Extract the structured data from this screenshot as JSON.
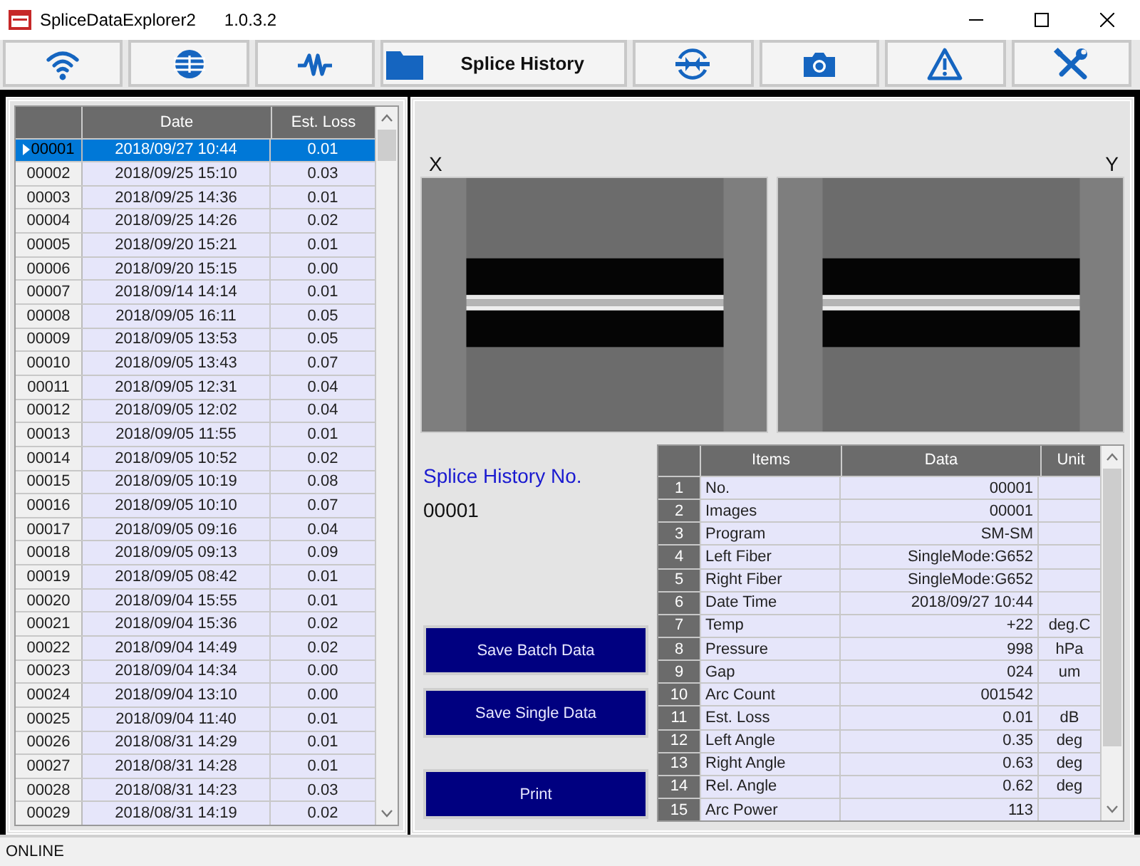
{
  "window": {
    "title": "SpliceDataExplorer2",
    "version": "1.0.3.2"
  },
  "toolbar": [
    {
      "kind": "wifi"
    },
    {
      "kind": "fiber"
    },
    {
      "kind": "wave"
    },
    {
      "kind": "folder",
      "label": "Splice History"
    },
    {
      "kind": "splice"
    },
    {
      "kind": "camera"
    },
    {
      "kind": "warning"
    },
    {
      "kind": "tools"
    }
  ],
  "history": {
    "columns": [
      "Date",
      "Est. Loss"
    ],
    "rows": [
      {
        "no": "00001",
        "date": "2018/09/27 10:44",
        "loss": "0.01",
        "selected": true
      },
      {
        "no": "00002",
        "date": "2018/09/25 15:10",
        "loss": "0.03",
        "selected": false
      },
      {
        "no": "00003",
        "date": "2018/09/25 14:36",
        "loss": "0.01",
        "selected": false
      },
      {
        "no": "00004",
        "date": "2018/09/25 14:26",
        "loss": "0.02",
        "selected": false
      },
      {
        "no": "00005",
        "date": "2018/09/20 15:21",
        "loss": "0.01",
        "selected": false
      },
      {
        "no": "00006",
        "date": "2018/09/20 15:15",
        "loss": "0.00",
        "selected": false
      },
      {
        "no": "00007",
        "date": "2018/09/14 14:14",
        "loss": "0.01",
        "selected": false
      },
      {
        "no": "00008",
        "date": "2018/09/05 16:11",
        "loss": "0.05",
        "selected": false
      },
      {
        "no": "00009",
        "date": "2018/09/05 13:53",
        "loss": "0.05",
        "selected": false
      },
      {
        "no": "00010",
        "date": "2018/09/05 13:43",
        "loss": "0.07",
        "selected": false
      },
      {
        "no": "00011",
        "date": "2018/09/05 12:31",
        "loss": "0.04",
        "selected": false
      },
      {
        "no": "00012",
        "date": "2018/09/05 12:02",
        "loss": "0.04",
        "selected": false
      },
      {
        "no": "00013",
        "date": "2018/09/05 11:55",
        "loss": "0.01",
        "selected": false
      },
      {
        "no": "00014",
        "date": "2018/09/05 10:52",
        "loss": "0.02",
        "selected": false
      },
      {
        "no": "00015",
        "date": "2018/09/05 10:19",
        "loss": "0.08",
        "selected": false
      },
      {
        "no": "00016",
        "date": "2018/09/05 10:10",
        "loss": "0.07",
        "selected": false
      },
      {
        "no": "00017",
        "date": "2018/09/05 09:16",
        "loss": "0.04",
        "selected": false
      },
      {
        "no": "00018",
        "date": "2018/09/05 09:13",
        "loss": "0.09",
        "selected": false
      },
      {
        "no": "00019",
        "date": "2018/09/05 08:42",
        "loss": "0.01",
        "selected": false
      },
      {
        "no": "00020",
        "date": "2018/09/04 15:55",
        "loss": "0.01",
        "selected": false
      },
      {
        "no": "00021",
        "date": "2018/09/04 15:36",
        "loss": "0.02",
        "selected": false
      },
      {
        "no": "00022",
        "date": "2018/09/04 14:49",
        "loss": "0.02",
        "selected": false
      },
      {
        "no": "00023",
        "date": "2018/09/04 14:34",
        "loss": "0.00",
        "selected": false
      },
      {
        "no": "00024",
        "date": "2018/09/04 13:10",
        "loss": "0.00",
        "selected": false
      },
      {
        "no": "00025",
        "date": "2018/09/04 11:40",
        "loss": "0.01",
        "selected": false
      },
      {
        "no": "00026",
        "date": "2018/08/31 14:29",
        "loss": "0.01",
        "selected": false
      },
      {
        "no": "00027",
        "date": "2018/08/31 14:28",
        "loss": "0.01",
        "selected": false
      },
      {
        "no": "00028",
        "date": "2018/08/31 14:23",
        "loss": "0.03",
        "selected": false
      },
      {
        "no": "00029",
        "date": "2018/08/31 14:19",
        "loss": "0.02",
        "selected": false
      }
    ]
  },
  "images": [
    {
      "label": "X",
      "kind": "picture"
    },
    {
      "label": "Y",
      "kind": "picture"
    }
  ],
  "detail": {
    "heading": "Splice History No.",
    "number": "00001"
  },
  "buttons": [
    "Save Batch Data",
    "Save Single Data",
    "Print"
  ],
  "data_table": {
    "columns": [
      "Items",
      "Data",
      "Unit"
    ],
    "rows": [
      {
        "index": "1",
        "item": "No.",
        "data": "00001"
      },
      {
        "index": "2",
        "item": "Images",
        "data": "00001"
      },
      {
        "index": "3",
        "item": "Program",
        "data": "SM-SM"
      },
      {
        "index": "4",
        "item": "Left Fiber",
        "data": "SingleMode:G652"
      },
      {
        "index": "5",
        "item": "Right Fiber",
        "data": "SingleMode:G652"
      },
      {
        "index": "6",
        "item": "Date Time",
        "data": "2018/09/27 10:44"
      },
      {
        "index": "7",
        "item": "Temp",
        "data": "+22",
        "unit": "deg.C"
      },
      {
        "index": "8",
        "item": "Pressure",
        "data": "998",
        "unit": "hPa"
      },
      {
        "index": "9",
        "item": "Gap",
        "data": "024",
        "unit": "um"
      },
      {
        "index": "10",
        "item": "Arc Count",
        "data": "001542"
      },
      {
        "index": "11",
        "item": "Est. Loss",
        "data": "0.01",
        "unit": "dB"
      },
      {
        "index": "12",
        "item": "Left Angle",
        "data": "0.35",
        "unit": "deg"
      },
      {
        "index": "13",
        "item": "Right Angle",
        "data": "0.63",
        "unit": "deg"
      },
      {
        "index": "14",
        "item": "Rel. Angle",
        "data": "0.62",
        "unit": "deg"
      },
      {
        "index": "15",
        "item": "Arc Power",
        "data": "113"
      }
    ]
  },
  "status_bar": "ONLINE"
}
